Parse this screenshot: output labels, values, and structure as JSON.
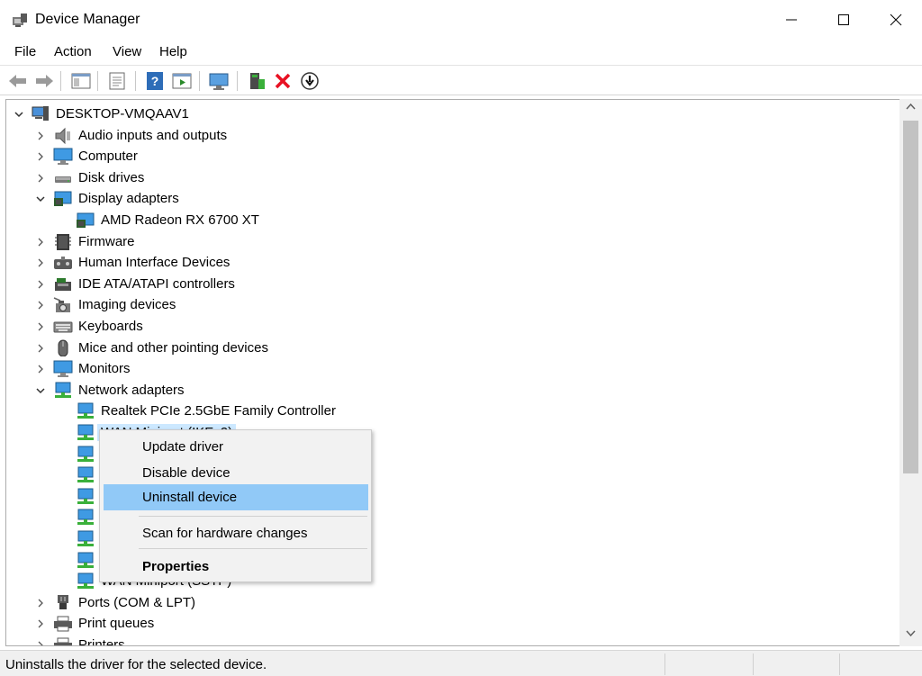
{
  "window": {
    "title": "Device Manager",
    "controls": [
      "minimize",
      "maximize",
      "close"
    ]
  },
  "menu": {
    "items": [
      "File",
      "Action",
      "View",
      "Help"
    ]
  },
  "toolbar": {
    "buttons": [
      "back-arrow-icon",
      "forward-arrow-icon",
      "show-hide-console-tree-icon",
      "properties-icon",
      "help-icon",
      "show-action-pane-icon",
      "scan-hardware-icon",
      "update-driver-icon",
      "uninstall-device-icon",
      "download-driver-icon"
    ]
  },
  "tree": {
    "root": "DESKTOP-VMQAAV1",
    "rows": [
      {
        "label": "Audio inputs and outputs",
        "expanded": false,
        "icon": "speaker-icon"
      },
      {
        "label": "Computer",
        "expanded": false,
        "icon": "computer-icon"
      },
      {
        "label": "Disk drives",
        "expanded": false,
        "icon": "disk-drive-icon"
      },
      {
        "label": "Display adapters",
        "expanded": true,
        "icon": "display-adapter-icon"
      },
      {
        "label": "AMD Radeon RX 6700 XT",
        "child": true,
        "icon": "display-adapter-icon"
      },
      {
        "label": "Firmware",
        "expanded": false,
        "icon": "firmware-icon"
      },
      {
        "label": "Human Interface Devices",
        "expanded": false,
        "icon": "hid-icon"
      },
      {
        "label": "IDE ATA/ATAPI controllers",
        "expanded": false,
        "icon": "ide-controller-icon"
      },
      {
        "label": "Imaging devices",
        "expanded": false,
        "icon": "camera-icon"
      },
      {
        "label": "Keyboards",
        "expanded": false,
        "icon": "keyboard-icon"
      },
      {
        "label": "Mice and other pointing devices",
        "expanded": false,
        "icon": "mouse-icon"
      },
      {
        "label": "Monitors",
        "expanded": false,
        "icon": "monitor-icon"
      },
      {
        "label": "Network adapters",
        "expanded": true,
        "icon": "network-adapter-icon"
      },
      {
        "label": "Realtek PCIe 2.5GbE Family Controller",
        "child": true,
        "icon": "network-adapter-icon"
      },
      {
        "label": "WAN Miniport (IKEv2)",
        "child": true,
        "selected": true,
        "icon": "network-adapter-icon"
      },
      {
        "label": "",
        "child": true,
        "icon": "network-adapter-icon"
      },
      {
        "label": "",
        "child": true,
        "icon": "network-adapter-icon"
      },
      {
        "label": "",
        "child": true,
        "icon": "network-adapter-icon"
      },
      {
        "label": "",
        "child": true,
        "icon": "network-adapter-icon"
      },
      {
        "label": "",
        "child": true,
        "icon": "network-adapter-icon"
      },
      {
        "label": "",
        "child": true,
        "icon": "network-adapter-icon"
      },
      {
        "label": "WAN Miniport (SSTP)",
        "child": true,
        "icon": "network-adapter-icon"
      },
      {
        "label": "Ports (COM & LPT)",
        "expanded": false,
        "icon": "port-icon"
      },
      {
        "label": "Print queues",
        "expanded": false,
        "icon": "printer-icon"
      },
      {
        "label": "Printers",
        "expanded": false,
        "icon": "printer-icon"
      }
    ]
  },
  "context_menu": {
    "items": [
      {
        "label": "Update driver"
      },
      {
        "label": "Disable device"
      },
      {
        "label": "Uninstall device",
        "highlighted": true
      },
      {
        "label": "Scan for hardware changes"
      },
      {
        "label": "Properties",
        "bold": true
      }
    ]
  },
  "status": {
    "text": "Uninstalls the driver for the selected device."
  },
  "colors": {
    "highlight": "#91c9f7",
    "selection": "#cce8ff",
    "delete_red": "#e81123"
  }
}
